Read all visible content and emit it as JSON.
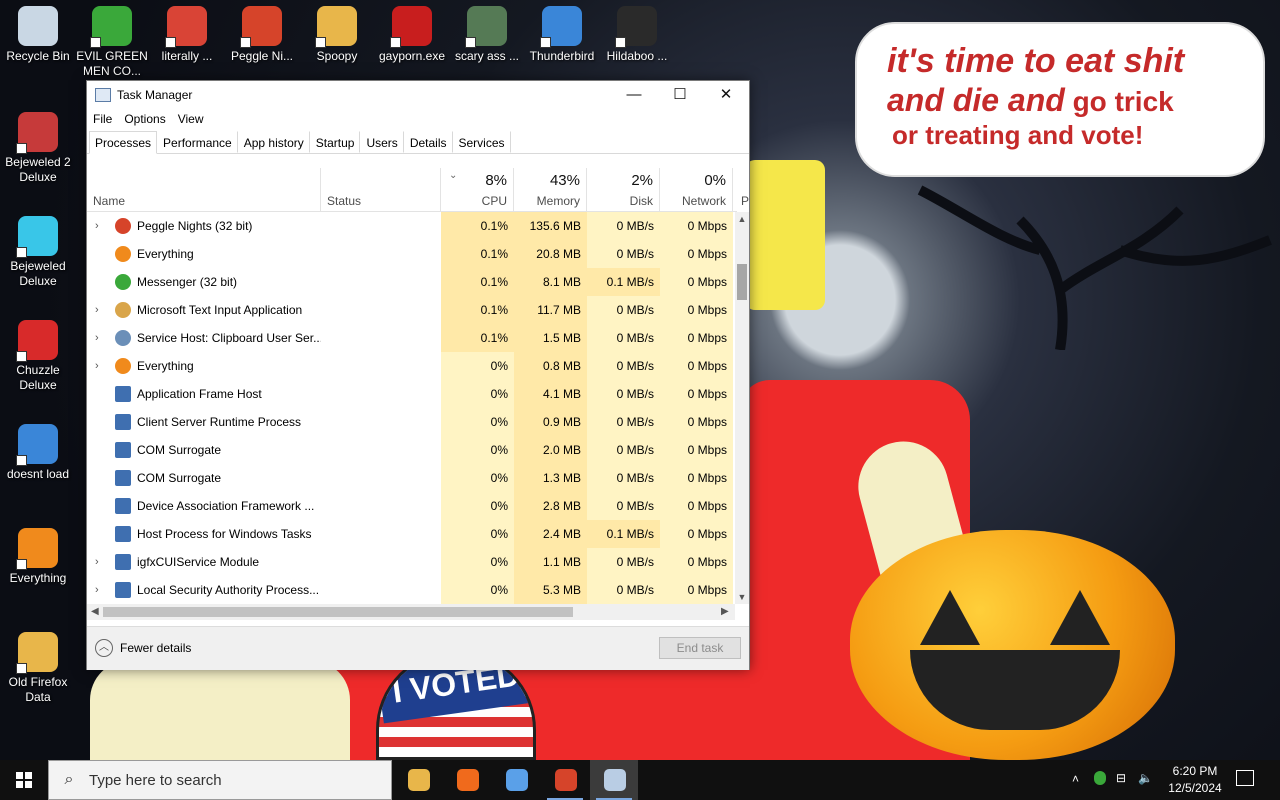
{
  "wallpaper": {
    "speech_line1": "it's time to eat shit",
    "speech_line2a": "and die and",
    "speech_line2b": " go trick",
    "speech_line3": "or treating and vote!",
    "badge_text": "I VOTED"
  },
  "desktop": {
    "icons": [
      {
        "label": "Recycle Bin",
        "icon": "recycle-bin-icon",
        "color": "#c9d7e4"
      },
      {
        "label": "EVIL GREEN MEN CO...",
        "icon": "messenger-icon",
        "color": "#3aa83a"
      },
      {
        "label": "literally ...",
        "icon": "chrome-icon",
        "color": "#d94436"
      },
      {
        "label": "Peggle Ni...",
        "icon": "peggle-icon",
        "color": "#d6442a"
      },
      {
        "label": "Spoopy",
        "icon": "folder-icon",
        "color": "#e8b64a"
      },
      {
        "label": "gayporn.exe",
        "icon": "flash-icon",
        "color": "#c81e1e"
      },
      {
        "label": "scary ass ...",
        "icon": "shield-icon",
        "color": "#557a55"
      },
      {
        "label": "Thunderbird",
        "icon": "thunderbird-icon",
        "color": "#3a86d8"
      },
      {
        "label": "Hildaboo ...",
        "icon": "shield-icon",
        "color": "#2a2a2a"
      },
      {
        "label": "Bejeweled 2 Deluxe",
        "icon": "bejeweled-2-icon",
        "color": "#c63a3a"
      },
      {
        "label": "Bejeweled Deluxe",
        "icon": "bejeweled-icon",
        "color": "#39c6e8"
      },
      {
        "label": "Chuzzle Deluxe",
        "icon": "chuzzle-icon",
        "color": "#d82a2a"
      },
      {
        "label": "doesnt load",
        "icon": "thunderbird-icon",
        "color": "#3a86d8"
      },
      {
        "label": "Everything",
        "icon": "everything-icon",
        "color": "#f08a1c"
      },
      {
        "label": "Old Firefox Data",
        "icon": "folder-icon",
        "color": "#e8b64a"
      }
    ]
  },
  "window": {
    "title": "Task Manager",
    "minimize": "—",
    "maximize": "☐",
    "close": "✕",
    "menu": [
      "File",
      "Options",
      "View"
    ],
    "tabs": [
      "Processes",
      "Performance",
      "App history",
      "Startup",
      "Users",
      "Details",
      "Services"
    ],
    "columns": {
      "name": "Name",
      "status": "Status",
      "cpu_pct": "8%",
      "cpu": "CPU",
      "mem_pct": "43%",
      "mem": "Memory",
      "disk_pct": "2%",
      "disk": "Disk",
      "net_pct": "0%",
      "net": "Network",
      "power": "P"
    },
    "processes": [
      {
        "name": "Peggle Nights (32 bit)",
        "expand": true,
        "icon": "peggle-icon",
        "color": "#d6442a",
        "cpu": "0.1%",
        "mem": "135.6 MB",
        "disk": "0 MB/s",
        "net": "0 Mbps"
      },
      {
        "name": "Everything",
        "expand": false,
        "icon": "everything-icon",
        "color": "#f08a1c",
        "cpu": "0.1%",
        "mem": "20.8 MB",
        "disk": "0 MB/s",
        "net": "0 Mbps"
      },
      {
        "name": "Messenger (32 bit)",
        "expand": false,
        "icon": "messenger-icon",
        "color": "#3aa83a",
        "cpu": "0.1%",
        "mem": "8.1 MB",
        "disk": "0.1 MB/s",
        "net": "0 Mbps"
      },
      {
        "name": "Microsoft Text Input Application",
        "expand": true,
        "icon": "text-input-icon",
        "color": "#d9a54a",
        "cpu": "0.1%",
        "mem": "11.7 MB",
        "disk": "0 MB/s",
        "net": "0 Mbps"
      },
      {
        "name": "Service Host: Clipboard User Ser...",
        "expand": true,
        "icon": "gear-icon",
        "color": "#6b8fb8",
        "cpu": "0.1%",
        "mem": "1.5 MB",
        "disk": "0 MB/s",
        "net": "0 Mbps"
      },
      {
        "name": "Everything",
        "expand": true,
        "icon": "everything-icon",
        "color": "#f08a1c",
        "cpu": "0%",
        "mem": "0.8 MB",
        "disk": "0 MB/s",
        "net": "0 Mbps"
      },
      {
        "name": "Application Frame Host",
        "expand": false,
        "icon": "app-window-icon",
        "color": "#3f6fb0",
        "cpu": "0%",
        "mem": "4.1 MB",
        "disk": "0 MB/s",
        "net": "0 Mbps"
      },
      {
        "name": "Client Server Runtime Process",
        "expand": false,
        "icon": "app-window-icon",
        "color": "#3f6fb0",
        "cpu": "0%",
        "mem": "0.9 MB",
        "disk": "0 MB/s",
        "net": "0 Mbps"
      },
      {
        "name": "COM Surrogate",
        "expand": false,
        "icon": "app-window-icon",
        "color": "#3f6fb0",
        "cpu": "0%",
        "mem": "2.0 MB",
        "disk": "0 MB/s",
        "net": "0 Mbps"
      },
      {
        "name": "COM Surrogate",
        "expand": false,
        "icon": "app-window-icon",
        "color": "#3f6fb0",
        "cpu": "0%",
        "mem": "1.3 MB",
        "disk": "0 MB/s",
        "net": "0 Mbps"
      },
      {
        "name": "Device Association Framework ...",
        "expand": false,
        "icon": "app-window-icon",
        "color": "#3f6fb0",
        "cpu": "0%",
        "mem": "2.8 MB",
        "disk": "0 MB/s",
        "net": "0 Mbps"
      },
      {
        "name": "Host Process for Windows Tasks",
        "expand": false,
        "icon": "app-window-icon",
        "color": "#3f6fb0",
        "cpu": "0%",
        "mem": "2.4 MB",
        "disk": "0.1 MB/s",
        "net": "0 Mbps"
      },
      {
        "name": "igfxCUIService Module",
        "expand": true,
        "icon": "app-window-icon",
        "color": "#3f6fb0",
        "cpu": "0%",
        "mem": "1.1 MB",
        "disk": "0 MB/s",
        "net": "0 Mbps"
      },
      {
        "name": "Local Security Authority Process...",
        "expand": true,
        "icon": "app-window-icon",
        "color": "#3f6fb0",
        "cpu": "0%",
        "mem": "5.3 MB",
        "disk": "0 MB/s",
        "net": "0 Mbps"
      }
    ],
    "fewer_details": "Fewer details",
    "end_task": "End task"
  },
  "taskbar": {
    "search_placeholder": "Type here to search",
    "apps": [
      {
        "icon": "file-explorer-icon",
        "color": "#e8b64a",
        "active": false,
        "open": false
      },
      {
        "icon": "firefox-icon",
        "color": "#f06a1c",
        "active": false,
        "open": false
      },
      {
        "icon": "cube-icon",
        "color": "#5aa0e8",
        "active": false,
        "open": false
      },
      {
        "icon": "peggle-icon",
        "color": "#d6442a",
        "active": false,
        "open": true
      },
      {
        "icon": "task-manager-icon",
        "color": "#b9cde4",
        "active": true,
        "open": true
      }
    ],
    "time": "6:20 PM",
    "date": "12/5/2024"
  }
}
